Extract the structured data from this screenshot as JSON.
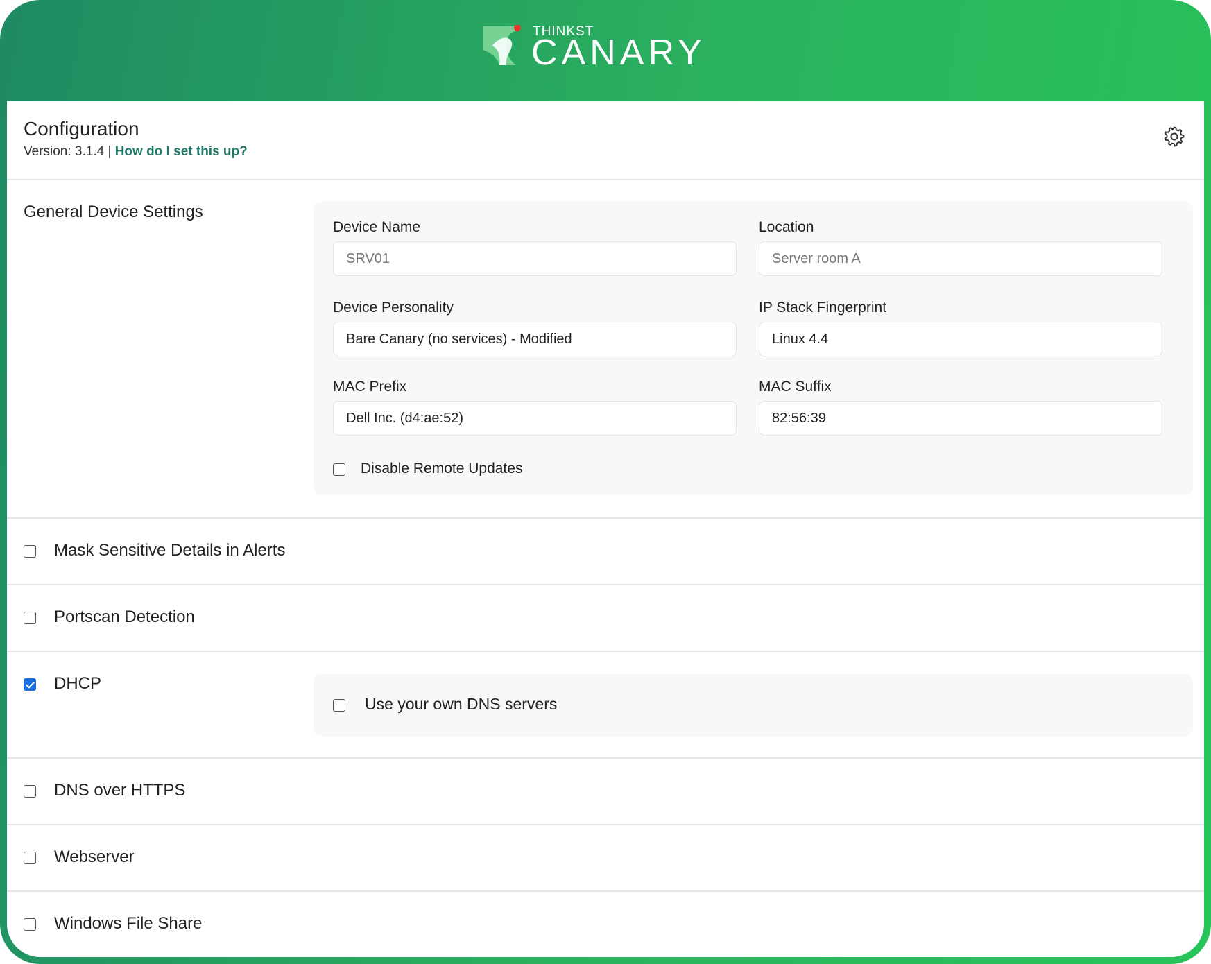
{
  "brand": {
    "top": "THINKST",
    "main": "CANARY"
  },
  "header": {
    "title": "Configuration",
    "version_text": "Version: 3.1.4 |",
    "help_link": "How do I set this up?"
  },
  "general": {
    "section_title": "General Device Settings",
    "device_name": {
      "label": "Device Name",
      "placeholder": "SRV01"
    },
    "location": {
      "label": "Location",
      "placeholder": "Server room A"
    },
    "personality": {
      "label": "Device Personality",
      "value": "Bare Canary (no services) - Modified"
    },
    "ip_stack": {
      "label": "IP Stack Fingerprint",
      "value": "Linux 4.4"
    },
    "mac_prefix": {
      "label": "MAC Prefix",
      "value": "Dell Inc. (d4:ae:52)"
    },
    "mac_suffix": {
      "label": "MAC Suffix",
      "value": "82:56:39"
    },
    "disable_updates": {
      "label": "Disable Remote Updates",
      "checked": false
    }
  },
  "options": {
    "mask": {
      "label": "Mask Sensitive Details in Alerts",
      "checked": false
    },
    "portscan": {
      "label": "Portscan Detection",
      "checked": false
    },
    "dhcp": {
      "label": "DHCP",
      "checked": true,
      "own_dns_label": "Use your own DNS servers",
      "own_dns_checked": false
    },
    "doh": {
      "label": "DNS over HTTPS",
      "checked": false
    },
    "webserver": {
      "label": "Webserver",
      "checked": false
    },
    "fileshare": {
      "label": "Windows File Share",
      "checked": false
    }
  },
  "colors": {
    "accent": "#1a6fe0",
    "link": "#1f7a6a",
    "header_start": "#1f8a63",
    "header_end": "#27c45a"
  }
}
